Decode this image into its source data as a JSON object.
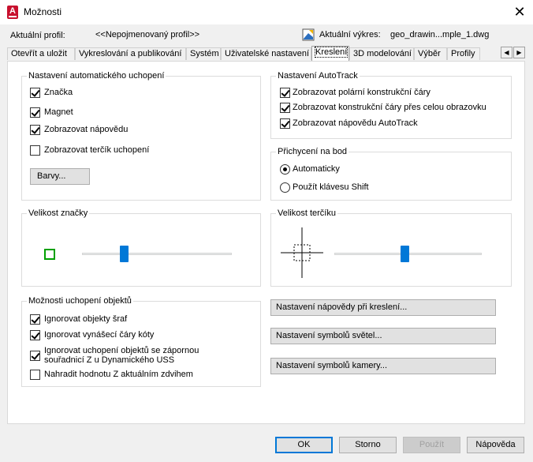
{
  "window": {
    "title": "Možnosti",
    "close_glyph": "✕"
  },
  "header": {
    "profile_label": "Aktuální profil:",
    "profile_value": "<<Nepojmenovaný profil>>",
    "drawing_label": "Aktuální výkres:",
    "drawing_value": "geo_drawin...mple_1.dwg"
  },
  "tabs": [
    {
      "label": "Otevřít a uložit"
    },
    {
      "label": "Vykreslování a publikování"
    },
    {
      "label": "Systém"
    },
    {
      "label": "Uživatelské nastavení"
    },
    {
      "label": "Kreslení",
      "active": true
    },
    {
      "label": "3D modelování"
    },
    {
      "label": "Výběr"
    },
    {
      "label": "Profily"
    }
  ],
  "autosnap": {
    "title": "Nastavení automatického uchopení",
    "items": [
      {
        "label": "Značka",
        "checked": true
      },
      {
        "label": "Magnet",
        "checked": true
      },
      {
        "label": "Zobrazovat nápovědu",
        "checked": true
      },
      {
        "label": "Zobrazovat terčík uchopení",
        "checked": false
      }
    ],
    "colors_button": "Barvy..."
  },
  "autotrack": {
    "title": "Nastavení AutoTrack",
    "items": [
      {
        "label": "Zobrazovat polární konstrukční čáry",
        "checked": true
      },
      {
        "label": "Zobrazovat konstrukční čáry přes celou obrazovku",
        "checked": true
      },
      {
        "label": "Zobrazovat nápovědu AutoTrack",
        "checked": true
      }
    ]
  },
  "alignment": {
    "title": "Přichycení na bod",
    "options": [
      {
        "label": "Automaticky",
        "selected": true
      },
      {
        "label": "Použít klávesu Shift",
        "selected": false
      }
    ]
  },
  "marker_size": {
    "title": "Velikost značky",
    "level": 0.27,
    "marker_color": "#00a000"
  },
  "aperture_size": {
    "title": "Velikost terčíku",
    "level": 0.48
  },
  "osnap_options": {
    "title": "Možnosti uchopení objektů",
    "items": [
      {
        "label": "Ignorovat objekty šraf",
        "checked": true
      },
      {
        "label": "Ignorovat vynášecí čáry kóty",
        "checked": true
      },
      {
        "label": "Ignorovat uchopení objektů se zápornou",
        "label2": "souřadnicí Z u Dynamického USS",
        "checked": true
      },
      {
        "label": "Nahradit hodnotu Z aktuálním zdvihem",
        "checked": false
      }
    ]
  },
  "settings_buttons": {
    "drafting_tooltip": "Nastavení nápovědy při kreslení...",
    "lights_glyph": "Nastavení symbolů světel...",
    "camera_glyph": "Nastavení symbolů kamery..."
  },
  "footer": {
    "ok": "OK",
    "cancel": "Storno",
    "apply": "Použít",
    "help": "Nápověda"
  },
  "colors": {
    "accent": "#0078d7",
    "app_red": "#c8102e"
  }
}
